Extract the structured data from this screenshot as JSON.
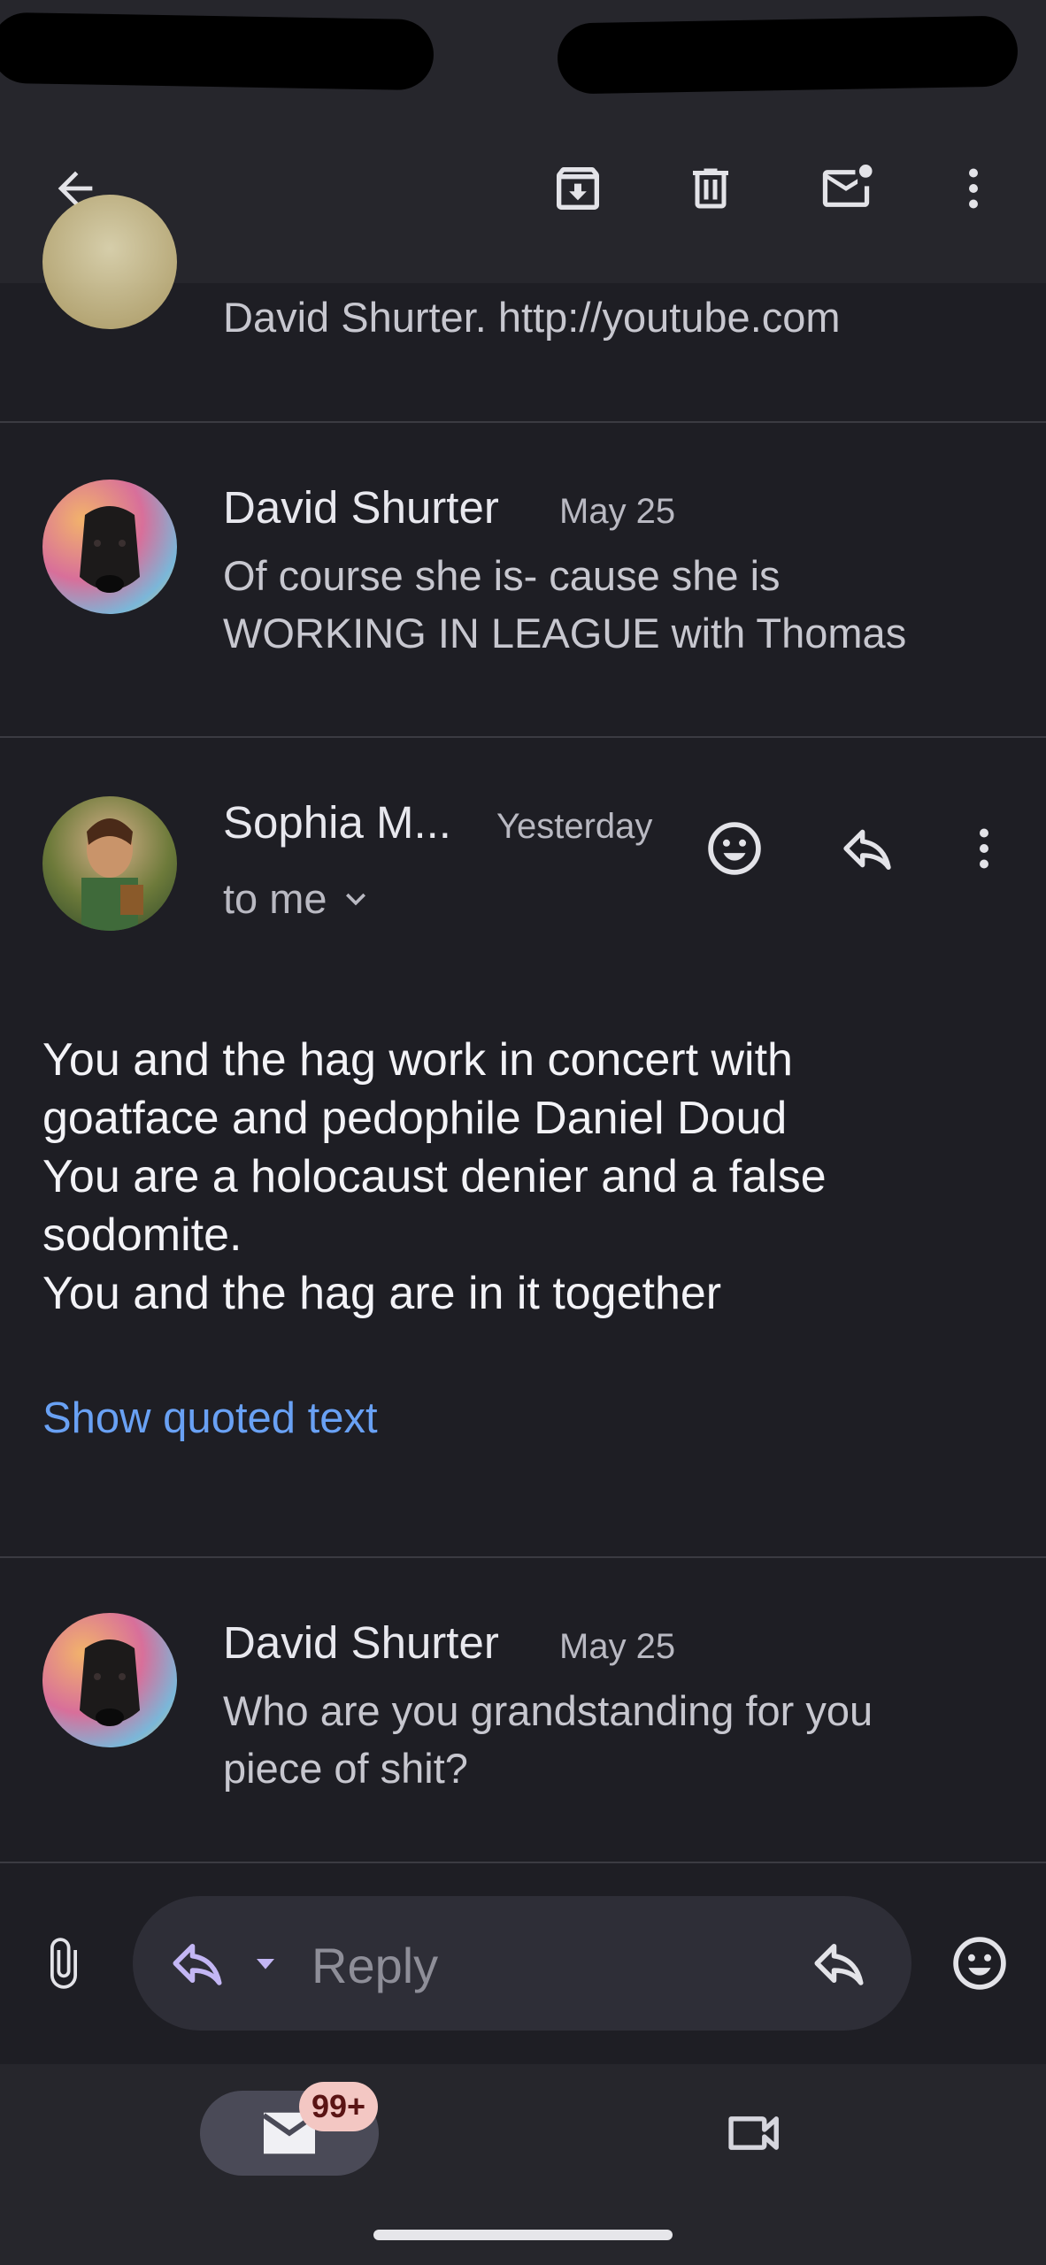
{
  "toolbar": {
    "back_icon": "arrow-back-icon",
    "archive_icon": "archive-icon",
    "delete_icon": "trash-icon",
    "mark_unread_icon": "mark-unread-icon",
    "more_icon": "more-vert-icon"
  },
  "messages": [
    {
      "sender": "",
      "date": "",
      "snippet_lines": [
        "David Shurter. http://youtube.com"
      ]
    },
    {
      "sender": "David Shurter",
      "date": "May 25",
      "snippet_lines": [
        "Of course she is- cause she is",
        "WORKING IN LEAGUE with Thomas"
      ]
    },
    {
      "sender": "Sophia M...",
      "date": "Yesterday",
      "recipient": "to me",
      "body_lines": [
        "You and the hag work in concert with",
        "goatface and pedophile Daniel Doud",
        "You are a holocaust denier and a false",
        "sodomite.",
        "You and the hag are in it together"
      ],
      "quoted_link": "Show quoted text"
    },
    {
      "sender": "David Shurter",
      "date": "May 25",
      "snippet_lines": [
        "Who are you grandstanding for you",
        "piece of shit?"
      ]
    }
  ],
  "reply_bar": {
    "placeholder": "Reply"
  },
  "bottom_nav": {
    "mail_badge": "99+"
  },
  "colors": {
    "background": "#1e1e24",
    "bar": "#26262c",
    "link": "#69a1f4",
    "badge": "#f3c7c3"
  }
}
